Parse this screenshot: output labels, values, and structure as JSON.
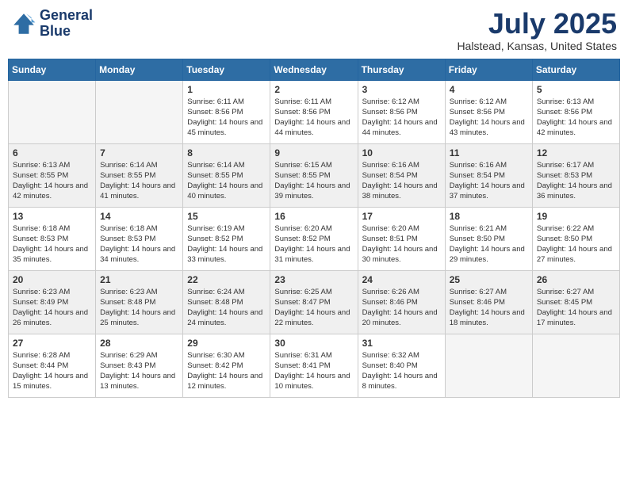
{
  "header": {
    "logo": {
      "line1": "General",
      "line2": "Blue"
    },
    "title": "July 2025",
    "location": "Halstead, Kansas, United States"
  },
  "weekdays": [
    "Sunday",
    "Monday",
    "Tuesday",
    "Wednesday",
    "Thursday",
    "Friday",
    "Saturday"
  ],
  "weeks": [
    [
      {
        "day": "",
        "empty": true
      },
      {
        "day": "",
        "empty": true
      },
      {
        "day": "1",
        "sunrise": "Sunrise: 6:11 AM",
        "sunset": "Sunset: 8:56 PM",
        "daylight": "Daylight: 14 hours and 45 minutes."
      },
      {
        "day": "2",
        "sunrise": "Sunrise: 6:11 AM",
        "sunset": "Sunset: 8:56 PM",
        "daylight": "Daylight: 14 hours and 44 minutes."
      },
      {
        "day": "3",
        "sunrise": "Sunrise: 6:12 AM",
        "sunset": "Sunset: 8:56 PM",
        "daylight": "Daylight: 14 hours and 44 minutes."
      },
      {
        "day": "4",
        "sunrise": "Sunrise: 6:12 AM",
        "sunset": "Sunset: 8:56 PM",
        "daylight": "Daylight: 14 hours and 43 minutes."
      },
      {
        "day": "5",
        "sunrise": "Sunrise: 6:13 AM",
        "sunset": "Sunset: 8:56 PM",
        "daylight": "Daylight: 14 hours and 42 minutes."
      }
    ],
    [
      {
        "day": "6",
        "sunrise": "Sunrise: 6:13 AM",
        "sunset": "Sunset: 8:55 PM",
        "daylight": "Daylight: 14 hours and 42 minutes."
      },
      {
        "day": "7",
        "sunrise": "Sunrise: 6:14 AM",
        "sunset": "Sunset: 8:55 PM",
        "daylight": "Daylight: 14 hours and 41 minutes."
      },
      {
        "day": "8",
        "sunrise": "Sunrise: 6:14 AM",
        "sunset": "Sunset: 8:55 PM",
        "daylight": "Daylight: 14 hours and 40 minutes."
      },
      {
        "day": "9",
        "sunrise": "Sunrise: 6:15 AM",
        "sunset": "Sunset: 8:55 PM",
        "daylight": "Daylight: 14 hours and 39 minutes."
      },
      {
        "day": "10",
        "sunrise": "Sunrise: 6:16 AM",
        "sunset": "Sunset: 8:54 PM",
        "daylight": "Daylight: 14 hours and 38 minutes."
      },
      {
        "day": "11",
        "sunrise": "Sunrise: 6:16 AM",
        "sunset": "Sunset: 8:54 PM",
        "daylight": "Daylight: 14 hours and 37 minutes."
      },
      {
        "day": "12",
        "sunrise": "Sunrise: 6:17 AM",
        "sunset": "Sunset: 8:53 PM",
        "daylight": "Daylight: 14 hours and 36 minutes."
      }
    ],
    [
      {
        "day": "13",
        "sunrise": "Sunrise: 6:18 AM",
        "sunset": "Sunset: 8:53 PM",
        "daylight": "Daylight: 14 hours and 35 minutes."
      },
      {
        "day": "14",
        "sunrise": "Sunrise: 6:18 AM",
        "sunset": "Sunset: 8:53 PM",
        "daylight": "Daylight: 14 hours and 34 minutes."
      },
      {
        "day": "15",
        "sunrise": "Sunrise: 6:19 AM",
        "sunset": "Sunset: 8:52 PM",
        "daylight": "Daylight: 14 hours and 33 minutes."
      },
      {
        "day": "16",
        "sunrise": "Sunrise: 6:20 AM",
        "sunset": "Sunset: 8:52 PM",
        "daylight": "Daylight: 14 hours and 31 minutes."
      },
      {
        "day": "17",
        "sunrise": "Sunrise: 6:20 AM",
        "sunset": "Sunset: 8:51 PM",
        "daylight": "Daylight: 14 hours and 30 minutes."
      },
      {
        "day": "18",
        "sunrise": "Sunrise: 6:21 AM",
        "sunset": "Sunset: 8:50 PM",
        "daylight": "Daylight: 14 hours and 29 minutes."
      },
      {
        "day": "19",
        "sunrise": "Sunrise: 6:22 AM",
        "sunset": "Sunset: 8:50 PM",
        "daylight": "Daylight: 14 hours and 27 minutes."
      }
    ],
    [
      {
        "day": "20",
        "sunrise": "Sunrise: 6:23 AM",
        "sunset": "Sunset: 8:49 PM",
        "daylight": "Daylight: 14 hours and 26 minutes."
      },
      {
        "day": "21",
        "sunrise": "Sunrise: 6:23 AM",
        "sunset": "Sunset: 8:48 PM",
        "daylight": "Daylight: 14 hours and 25 minutes."
      },
      {
        "day": "22",
        "sunrise": "Sunrise: 6:24 AM",
        "sunset": "Sunset: 8:48 PM",
        "daylight": "Daylight: 14 hours and 24 minutes."
      },
      {
        "day": "23",
        "sunrise": "Sunrise: 6:25 AM",
        "sunset": "Sunset: 8:47 PM",
        "daylight": "Daylight: 14 hours and 22 minutes."
      },
      {
        "day": "24",
        "sunrise": "Sunrise: 6:26 AM",
        "sunset": "Sunset: 8:46 PM",
        "daylight": "Daylight: 14 hours and 20 minutes."
      },
      {
        "day": "25",
        "sunrise": "Sunrise: 6:27 AM",
        "sunset": "Sunset: 8:46 PM",
        "daylight": "Daylight: 14 hours and 18 minutes."
      },
      {
        "day": "26",
        "sunrise": "Sunrise: 6:27 AM",
        "sunset": "Sunset: 8:45 PM",
        "daylight": "Daylight: 14 hours and 17 minutes."
      }
    ],
    [
      {
        "day": "27",
        "sunrise": "Sunrise: 6:28 AM",
        "sunset": "Sunset: 8:44 PM",
        "daylight": "Daylight: 14 hours and 15 minutes."
      },
      {
        "day": "28",
        "sunrise": "Sunrise: 6:29 AM",
        "sunset": "Sunset: 8:43 PM",
        "daylight": "Daylight: 14 hours and 13 minutes."
      },
      {
        "day": "29",
        "sunrise": "Sunrise: 6:30 AM",
        "sunset": "Sunset: 8:42 PM",
        "daylight": "Daylight: 14 hours and 12 minutes."
      },
      {
        "day": "30",
        "sunrise": "Sunrise: 6:31 AM",
        "sunset": "Sunset: 8:41 PM",
        "daylight": "Daylight: 14 hours and 10 minutes."
      },
      {
        "day": "31",
        "sunrise": "Sunrise: 6:32 AM",
        "sunset": "Sunset: 8:40 PM",
        "daylight": "Daylight: 14 hours and 8 minutes."
      },
      {
        "day": "",
        "empty": true
      },
      {
        "day": "",
        "empty": true
      }
    ]
  ]
}
